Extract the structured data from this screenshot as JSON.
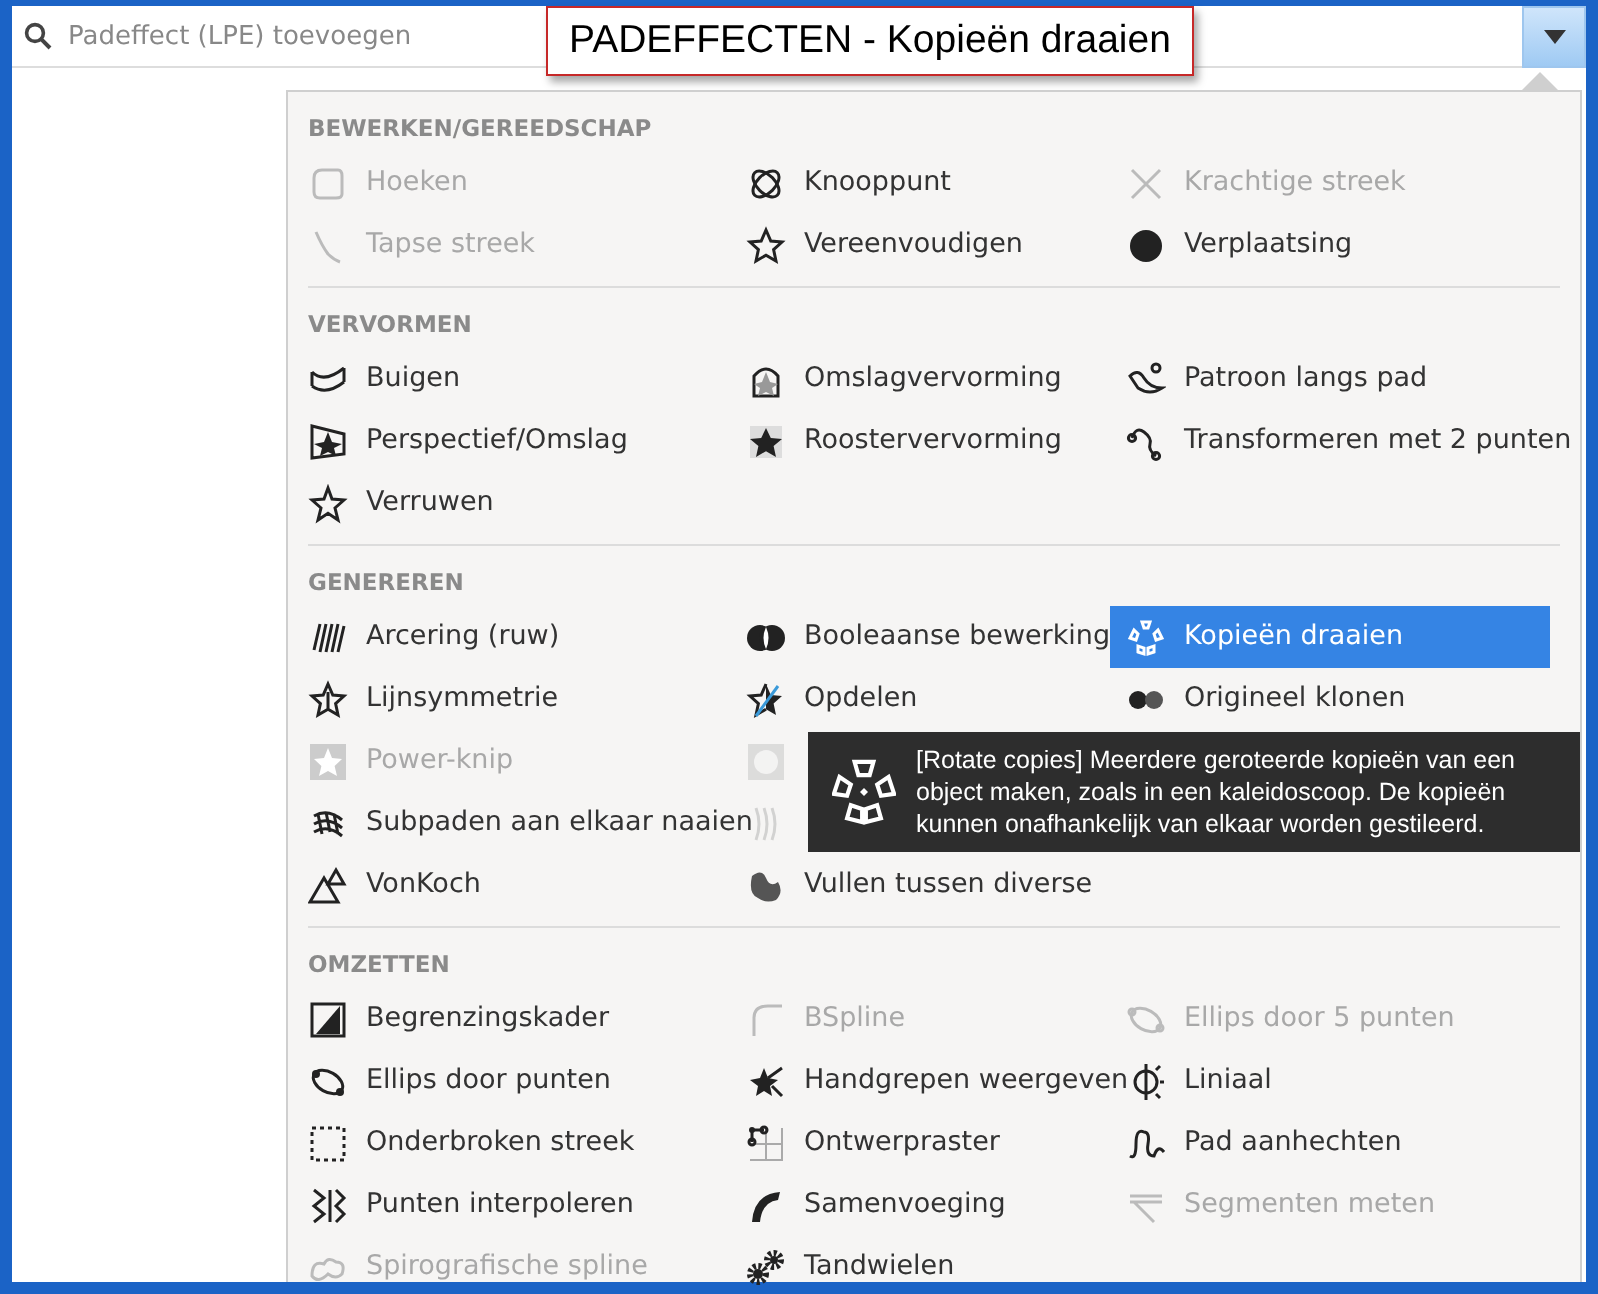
{
  "search": {
    "placeholder": "Padeffect (LPE) toevoegen"
  },
  "caption": "PADEFFECTEN - Kopieën draaien",
  "sections": [
    {
      "title": "BEWERKEN/GEREEDSCHAP",
      "items": [
        {
          "kind": "effect",
          "label": "Hoeken",
          "disabled": true,
          "selected": false
        },
        {
          "kind": "effect",
          "label": "Knooppunt",
          "disabled": false,
          "selected": false
        },
        {
          "kind": "effect",
          "label": "Krachtige streek",
          "disabled": true,
          "selected": false
        },
        {
          "kind": "effect",
          "label": "Tapse streek",
          "disabled": true,
          "selected": false
        },
        {
          "kind": "effect",
          "label": "Vereenvoudigen",
          "disabled": false,
          "selected": false
        },
        {
          "kind": "effect",
          "label": "Verplaatsing",
          "disabled": false,
          "selected": false
        }
      ]
    },
    {
      "title": "VERVORMEN",
      "items": [
        {
          "kind": "effect",
          "label": "Buigen",
          "disabled": false,
          "selected": false
        },
        {
          "kind": "effect",
          "label": "Omslagvervorming",
          "disabled": false,
          "selected": false
        },
        {
          "kind": "effect",
          "label": "Patroon langs pad",
          "disabled": false,
          "selected": false
        },
        {
          "kind": "effect",
          "label": "Perspectief/Omslag",
          "disabled": false,
          "selected": false
        },
        {
          "kind": "effect",
          "label": "Roostervervorming",
          "disabled": false,
          "selected": false
        },
        {
          "kind": "effect",
          "label": "Transformeren met 2 punten",
          "disabled": false,
          "selected": false
        },
        {
          "kind": "effect",
          "label": "Verruwen",
          "disabled": false,
          "selected": false
        }
      ]
    },
    {
      "title": "GENEREREN",
      "items": [
        {
          "kind": "effect",
          "label": "Arcering (ruw)",
          "disabled": false,
          "selected": false
        },
        {
          "kind": "effect",
          "label": "Booleaanse bewerking",
          "disabled": false,
          "selected": false
        },
        {
          "kind": "effect",
          "label": "Kopieën draaien",
          "disabled": false,
          "selected": true
        },
        {
          "kind": "effect",
          "label": "Lijnsymmetrie",
          "disabled": false,
          "selected": false
        },
        {
          "kind": "effect",
          "label": "Opdelen",
          "disabled": false,
          "selected": false
        },
        {
          "kind": "effect",
          "label": "Origineel klonen",
          "disabled": false,
          "selected": false
        },
        {
          "kind": "effect",
          "label": "Power-knip",
          "disabled": true,
          "selected": false
        },
        {
          "kind": "covered",
          "disabled": true
        },
        {
          "kind": "hidden"
        },
        {
          "kind": "effect",
          "label": "Subpaden aan elkaar naaien",
          "disabled": false,
          "selected": false
        },
        {
          "kind": "covered",
          "disabled": true
        },
        {
          "kind": "hidden"
        },
        {
          "kind": "effect",
          "label": "VonKoch",
          "disabled": false,
          "selected": false
        },
        {
          "kind": "effect",
          "label": "Vullen tussen diverse",
          "disabled": false,
          "selected": false
        }
      ]
    },
    {
      "title": "OMZETTEN",
      "items": [
        {
          "kind": "effect",
          "label": "Begrenzingskader",
          "disabled": false,
          "selected": false
        },
        {
          "kind": "effect",
          "label": "BSpline",
          "disabled": true,
          "selected": false
        },
        {
          "kind": "effect",
          "label": "Ellips door 5 punten",
          "disabled": true,
          "selected": false
        },
        {
          "kind": "effect",
          "label": "Ellips door punten",
          "disabled": false,
          "selected": false
        },
        {
          "kind": "effect",
          "label": "Handgrepen weergeven",
          "disabled": false,
          "selected": false
        },
        {
          "kind": "effect",
          "label": "Liniaal",
          "disabled": false,
          "selected": false
        },
        {
          "kind": "effect",
          "label": "Onderbroken streek",
          "disabled": false,
          "selected": false
        },
        {
          "kind": "effect",
          "label": "Ontwerpraster",
          "disabled": false,
          "selected": false
        },
        {
          "kind": "effect",
          "label": "Pad aanhechten",
          "disabled": false,
          "selected": false
        },
        {
          "kind": "effect",
          "label": "Punten interpoleren",
          "disabled": false,
          "selected": false
        },
        {
          "kind": "effect",
          "label": "Samenvoeging",
          "disabled": false,
          "selected": false
        },
        {
          "kind": "effect",
          "label": "Segmenten meten",
          "disabled": true,
          "selected": false
        },
        {
          "kind": "effect",
          "label": "Spirografische spline",
          "disabled": true,
          "selected": false
        },
        {
          "kind": "effect",
          "label": "Tandwielen",
          "disabled": false,
          "selected": false
        }
      ]
    }
  ],
  "tooltip": {
    "text": "[Rotate copies] Meerdere geroteerde kopieën van een object maken, zoals in een kaleidoscoop. De kopieën kunnen onafhankelijk van elkaar worden gestileerd."
  }
}
